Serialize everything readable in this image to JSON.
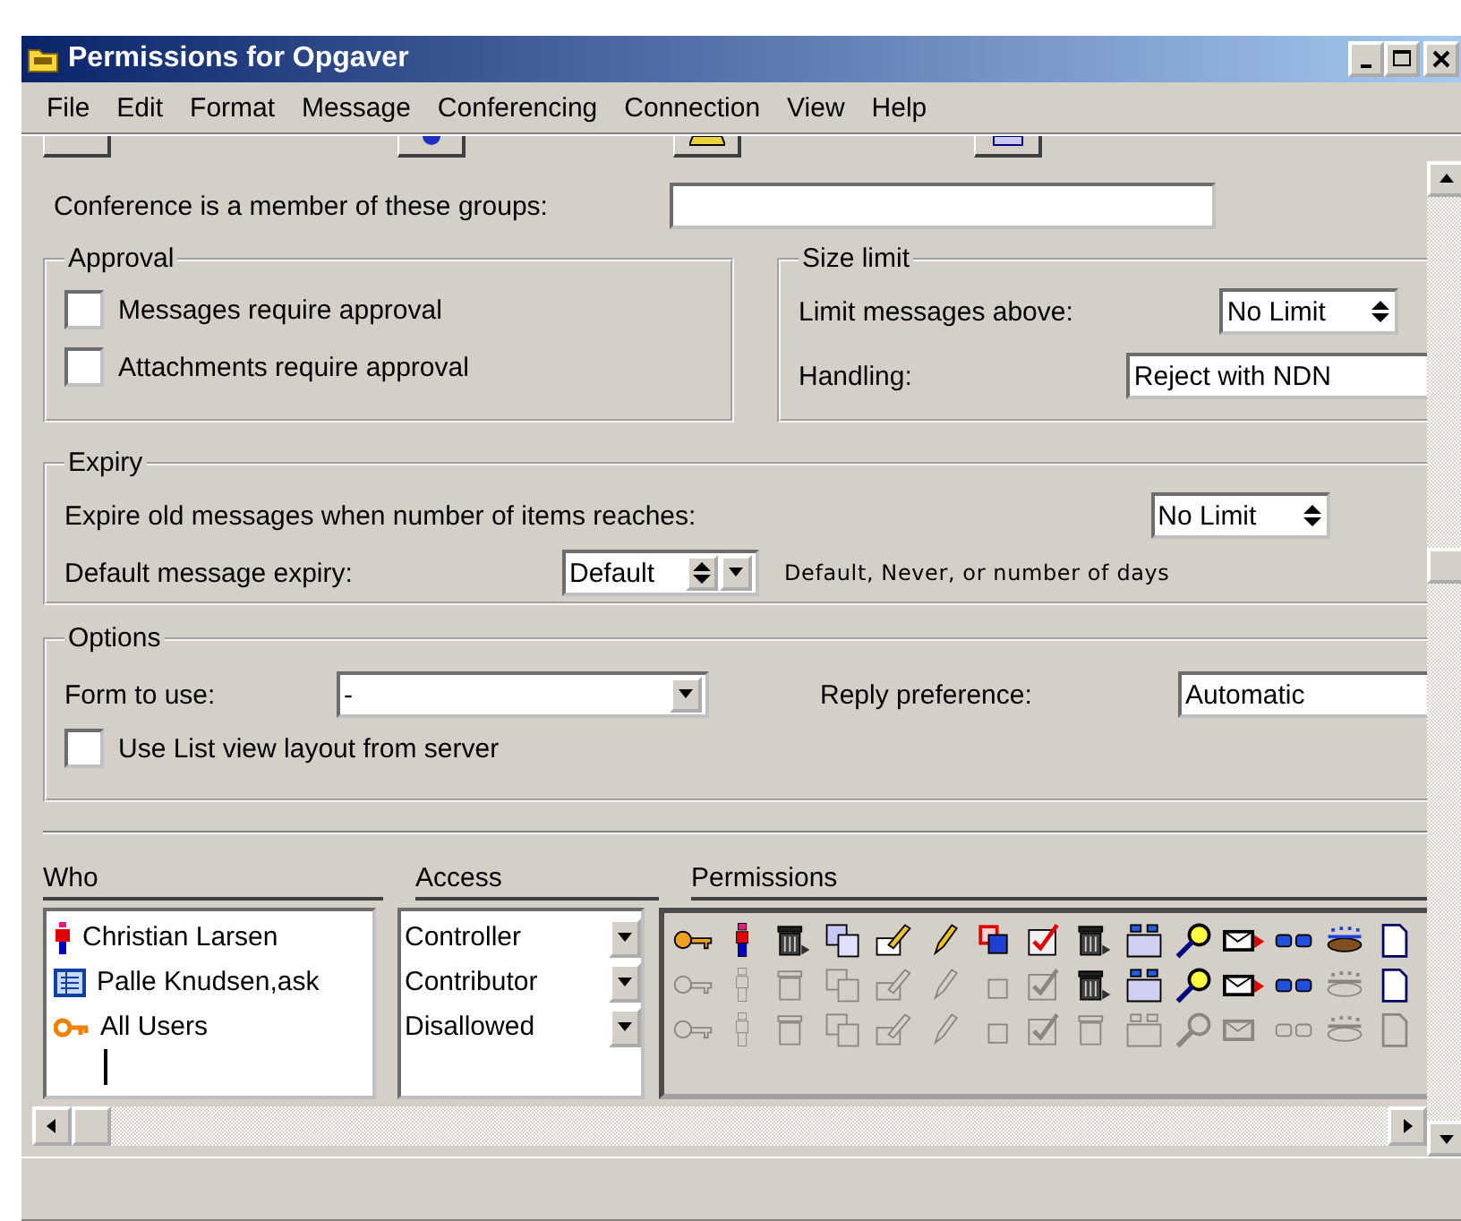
{
  "window": {
    "title": "Permissions for Opgaver"
  },
  "menu": [
    "File",
    "Edit",
    "Format",
    "Message",
    "Conferencing",
    "Connection",
    "View",
    "Help"
  ],
  "groups_field": {
    "label": "Conference is a member of these groups:"
  },
  "approval": {
    "title": "Approval",
    "options": [
      {
        "label": "Messages require approval",
        "checked": false
      },
      {
        "label": "Attachments require approval",
        "checked": false
      }
    ]
  },
  "size_limit": {
    "title": "Size limit",
    "limit_label": "Limit messages above:",
    "limit_value": "No Limit",
    "handling_label": "Handling:",
    "handling_value": "Reject with NDN"
  },
  "expiry": {
    "title": "Expiry",
    "items_label": "Expire old messages when number of items reaches:",
    "items_value": "No Limit",
    "default_label": "Default message expiry:",
    "default_value": "Default",
    "hint": "Default, Never, or number of days"
  },
  "options": {
    "title": "Options",
    "form_label": "Form to use:",
    "form_value": "-",
    "reply_label": "Reply preference:",
    "reply_value": "Automatic",
    "list_view": {
      "label": "Use List view layout from server",
      "checked": false
    }
  },
  "headers": {
    "who": "Who",
    "access": "Access",
    "permissions": "Permissions"
  },
  "permission_icons": [
    {
      "kind": "key"
    },
    {
      "kind": "person"
    },
    {
      "kind": "trash"
    },
    {
      "kind": "copy"
    },
    {
      "kind": "sign"
    },
    {
      "kind": "pencil"
    },
    {
      "kind": "squares"
    },
    {
      "kind": "check"
    },
    {
      "kind": "trash"
    },
    {
      "kind": "folder"
    },
    {
      "kind": "search"
    },
    {
      "kind": "mail"
    },
    {
      "kind": "glasses"
    },
    {
      "kind": "group"
    },
    {
      "kind": "page"
    }
  ],
  "entries": [
    {
      "name": "Christian Larsen",
      "kind": "person",
      "access": "Controller",
      "granted": [
        true,
        true,
        true,
        true,
        true,
        true,
        true,
        true,
        true,
        true,
        true,
        true,
        true,
        true,
        true
      ]
    },
    {
      "name": "Palle Knudsen,ask",
      "kind": "list",
      "access": "Contributor",
      "granted": [
        false,
        false,
        false,
        false,
        false,
        false,
        false,
        false,
        true,
        true,
        true,
        true,
        true,
        false,
        true
      ]
    },
    {
      "name": "All Users",
      "kind": "key",
      "access": "Disallowed",
      "granted": [
        false,
        false,
        false,
        false,
        false,
        false,
        false,
        false,
        false,
        false,
        false,
        false,
        false,
        false,
        false
      ]
    }
  ]
}
